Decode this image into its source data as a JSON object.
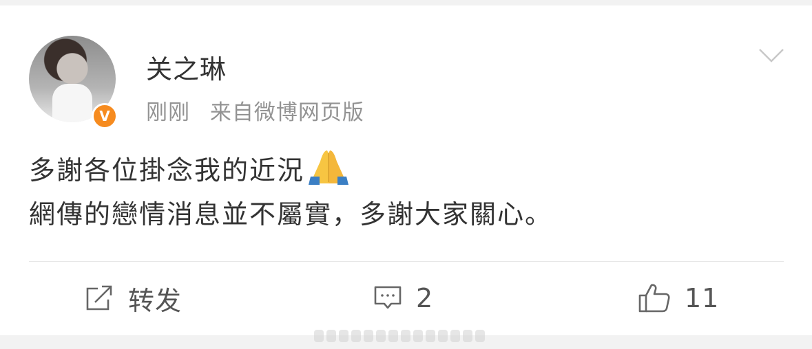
{
  "post": {
    "author_name": "关之琳",
    "timestamp": "刚刚",
    "source": "来自微博网页版",
    "content_line1": "多謝各位掛念我的近況",
    "content_line2": "網傳的戀情消息並不屬實，多謝大家關心。",
    "emoji": "folded-hands",
    "verified_badge": "V",
    "badge_color": "#f68b1f"
  },
  "actions": {
    "repost_label": "转发",
    "comment_count": "2",
    "like_count": "11"
  },
  "icons": {
    "menu": "chevron-down-icon",
    "repost": "share-icon",
    "comment": "comment-icon",
    "like": "thumbs-up-icon"
  }
}
